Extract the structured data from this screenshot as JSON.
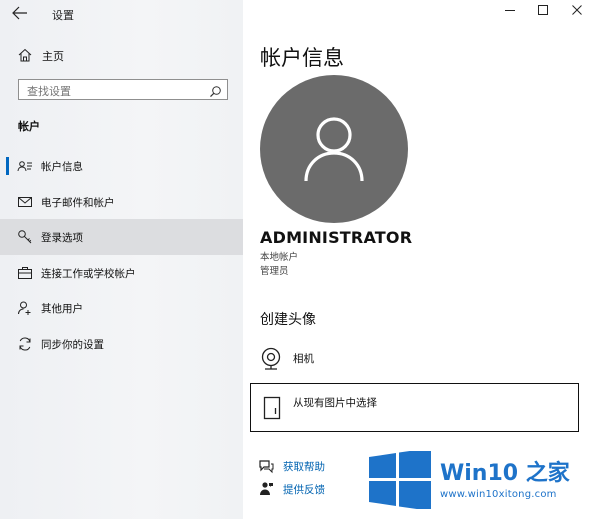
{
  "window": {
    "title": "设置"
  },
  "sidebar": {
    "home_label": "主页",
    "search_placeholder": "查找设置",
    "section_label": "帐户",
    "items": [
      {
        "label": "帐户信息",
        "icon": "person-card-icon"
      },
      {
        "label": "电子邮件和帐户",
        "icon": "mail-icon"
      },
      {
        "label": "登录选项",
        "icon": "key-icon"
      },
      {
        "label": "连接工作或学校帐户",
        "icon": "briefcase-icon"
      },
      {
        "label": "其他用户",
        "icon": "person-add-icon"
      },
      {
        "label": "同步你的设置",
        "icon": "sync-icon"
      }
    ]
  },
  "main": {
    "page_title": "帐户信息",
    "user_name": "ADMINISTRATOR",
    "account_type": "本地帐户",
    "role": "管理员",
    "create_avatar_heading": "创建头像",
    "camera_label": "相机",
    "choose_image_label": "从现有图片中选择",
    "help_label": "获取帮助",
    "feedback_label": "提供反馈"
  },
  "watermark": {
    "brand": "Win10 之家",
    "url": "www.win10xitong.com"
  },
  "colors": {
    "accent": "#0067c0",
    "link": "#0063b1",
    "avatar_bg": "#6b6b6b",
    "watermark_blue": "#1e73c9"
  }
}
